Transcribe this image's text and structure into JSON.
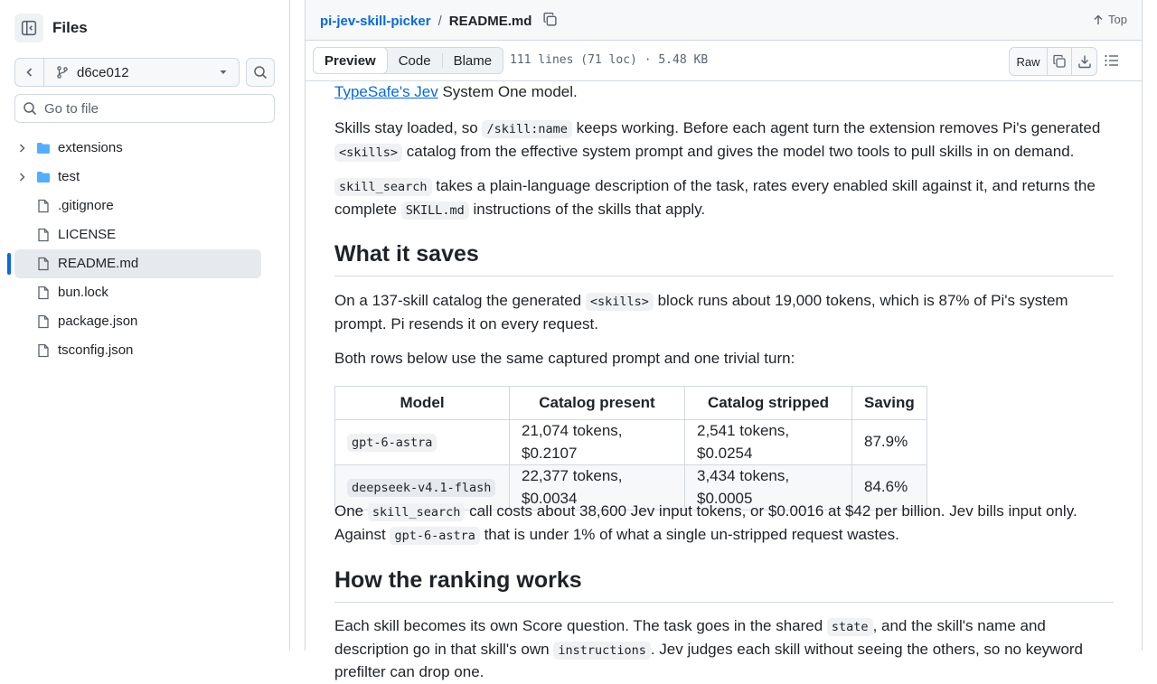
{
  "sidebar": {
    "title": "Files",
    "branch": "d6ce012",
    "goto_placeholder": "Go to file",
    "items": [
      {
        "label": "extensions",
        "type": "folder"
      },
      {
        "label": "test",
        "type": "folder"
      },
      {
        "label": ".gitignore",
        "type": "file"
      },
      {
        "label": "LICENSE",
        "type": "file"
      },
      {
        "label": "README.md",
        "type": "file",
        "selected": true
      },
      {
        "label": "bun.lock",
        "type": "file"
      },
      {
        "label": "package.json",
        "type": "file"
      },
      {
        "label": "tsconfig.json",
        "type": "file"
      }
    ]
  },
  "header": {
    "repo": "pi-jev-skill-picker",
    "separator": "/",
    "file": "README.md",
    "top_label": "Top"
  },
  "toolbar": {
    "tabs": [
      "Preview",
      "Code",
      "Blame"
    ],
    "active_tab": "Preview",
    "file_info": "111 lines (71 loc) · 5.48 KB",
    "raw_label": "Raw"
  },
  "article": {
    "p0": {
      "link": "TypeSafe's Jev",
      "rest": " System One model."
    },
    "p1": {
      "a": "Skills stay loaded, so ",
      "code1": "/skill:name",
      "b": " keeps working. Before each agent turn the extension removes Pi's generated ",
      "code2": "<skills>",
      "c": " catalog from the effective system prompt and gives the model two tools to pull skills in on demand."
    },
    "p2": {
      "code1": "skill_search",
      "a": " takes a plain-language description of the task, rates every enabled skill against it, and returns the complete ",
      "code2": "SKILL.md",
      "b": " instructions of the skills that apply."
    },
    "h_saves": "What it saves",
    "p3": {
      "a": "On a 137-skill catalog the generated ",
      "code1": "<skills>",
      "b": " block runs about 19,000 tokens, which is 87% of Pi's system prompt. Pi resends it on every request."
    },
    "p4": "Both rows below use the same captured prompt and one trivial turn:",
    "table": {
      "headers": [
        "Model",
        "Catalog present",
        "Catalog stripped",
        "Saving"
      ],
      "rows": [
        [
          "gpt-6-astra",
          "21,074 tokens, $0.2107",
          "2,541 tokens, $0.0254",
          "87.9%"
        ],
        [
          "deepseek-v4.1-flash",
          "22,377 tokens, $0.0034",
          "3,434 tokens, $0.0005",
          "84.6%"
        ]
      ]
    },
    "p5": {
      "a": "One ",
      "code1": "skill_search",
      "b": " call costs about 38,600 Jev input tokens, or $0.0016 at $42 per billion. Jev bills input only. Against ",
      "code2": "gpt-6-astra",
      "c": " that is under 1% of what a single un-stripped request wastes."
    },
    "h_ranking": "How the ranking works",
    "p6": {
      "a": "Each skill becomes its own Score question. The task goes in the shared ",
      "code1": "state",
      "b": ", and the skill's name and description go in that skill's own ",
      "code2": "instructions",
      "c": ". Jev judges each skill without seeing the others, so no keyword prefilter can drop one."
    }
  },
  "colors": {
    "accent": "#0969da",
    "folder": "#54aeff",
    "border": "#d1d9e0"
  }
}
